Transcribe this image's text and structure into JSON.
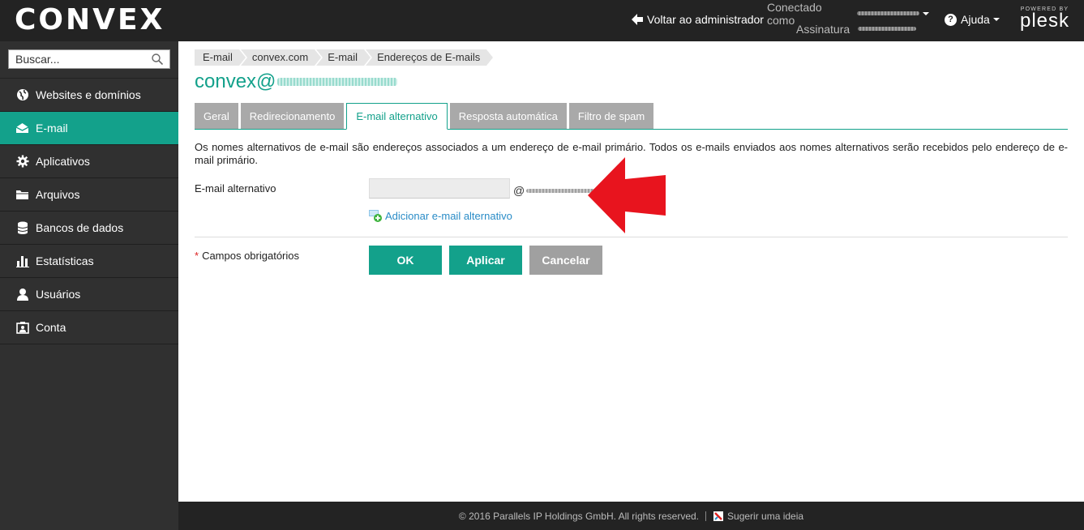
{
  "topbar": {
    "logo": "CONVEX",
    "back_label": "Voltar ao administrador",
    "logged_in_label": "Conectado como",
    "subscription_label": "Assinatura",
    "help_label": "Ajuda",
    "powered_by": "POWERED BY",
    "plesk": "plesk"
  },
  "sidebar": {
    "search_placeholder": "Buscar...",
    "items": [
      {
        "label": "Websites e domínios",
        "icon": "globe-icon"
      },
      {
        "label": "E-mail",
        "icon": "envelope-icon",
        "active": true
      },
      {
        "label": "Aplicativos",
        "icon": "gear-icon"
      },
      {
        "label": "Arquivos",
        "icon": "folder-icon"
      },
      {
        "label": "Bancos de dados",
        "icon": "database-icon"
      },
      {
        "label": "Estatísticas",
        "icon": "bar-chart-icon"
      },
      {
        "label": "Usuários",
        "icon": "user-icon"
      },
      {
        "label": "Conta",
        "icon": "account-icon"
      }
    ]
  },
  "breadcrumb": [
    "E-mail",
    "convex.com",
    "E-mail",
    "Endereços de E-mails"
  ],
  "page_title": "convex@",
  "tabs": [
    {
      "label": "Geral",
      "active": false
    },
    {
      "label": "Redirecionamento",
      "active": false
    },
    {
      "label": "E-mail alternativo",
      "active": true
    },
    {
      "label": "Resposta automática",
      "active": false
    },
    {
      "label": "Filtro de spam",
      "active": false
    }
  ],
  "description": "Os nomes alternativos de e-mail são endereços associados a um endereço de e-mail primário. Todos os e-mails enviados aos nomes alternativos serão recebidos pelo endereço de e-mail primário.",
  "form": {
    "alias_label": "E-mail alternativo",
    "alias_value": "",
    "at_sign": "@",
    "add_link": "Adicionar e-mail alternativo",
    "required_star": "*",
    "required_label": "Campos obrigatórios",
    "ok": "OK",
    "apply": "Aplicar",
    "cancel": "Cancelar"
  },
  "footer": {
    "copyright": "© 2016 Parallels IP Holdings GmbH. All rights reserved.",
    "suggest": "Sugerir uma ideia"
  },
  "colors": {
    "accent": "#13a18b",
    "topbar": "#232323",
    "sidebar": "#303030",
    "annotation_arrow": "#e8141e"
  }
}
